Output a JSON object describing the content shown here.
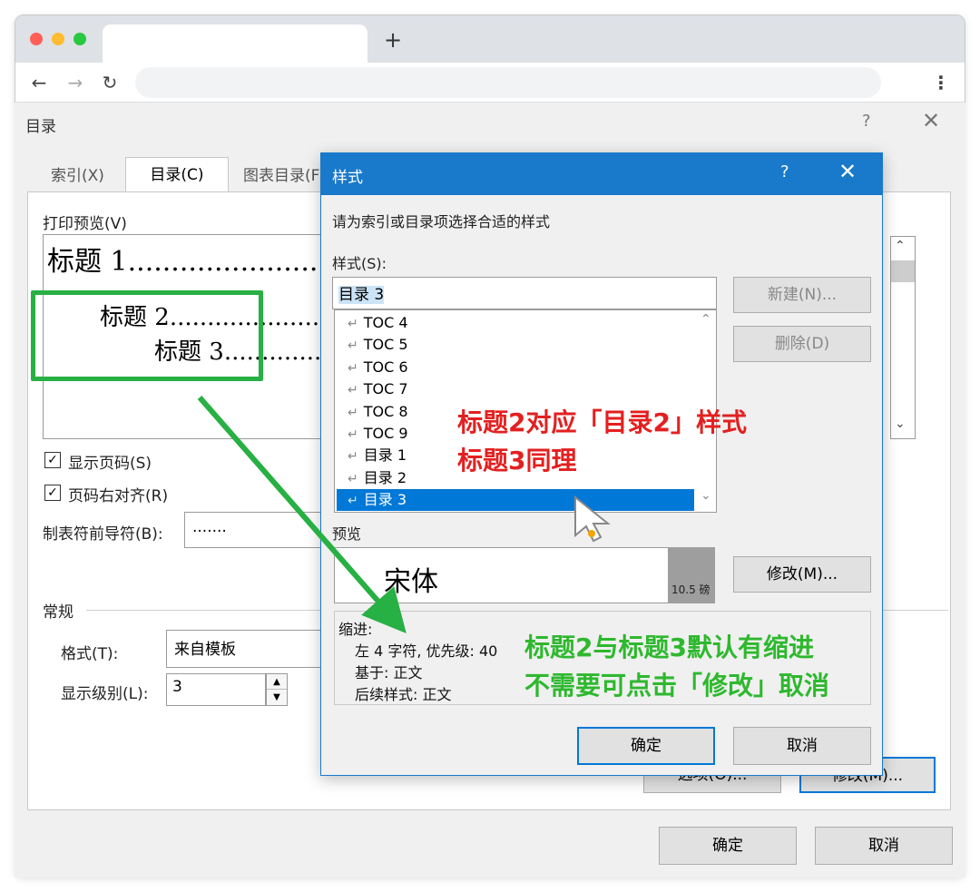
{
  "browser": {
    "new_tab_label": "+",
    "menu_dots": "⋮"
  },
  "toc_dialog": {
    "title": "目录",
    "help": "?",
    "close": "✕",
    "tabs": [
      {
        "label": "索引(X)"
      },
      {
        "label": "目录(C)"
      },
      {
        "label": "图表目录(F"
      }
    ],
    "print_preview_label": "打印预览(V)",
    "preview": {
      "h1": "标题  1",
      "h1_dots": ".........................",
      "h2": "标题  2",
      "h2_dots": ".........................",
      "h3": "标题  3",
      "h3_dots": "...................."
    },
    "show_page_numbers": "显示页码(S)",
    "right_align": "页码右对齐(R)",
    "tab_leader_label": "制表符前导符(B):",
    "tab_leader_value": ".......",
    "general_label": "常规",
    "format_label": "格式(T):",
    "format_value": "来自模板",
    "levels_label": "显示级别(L):",
    "levels_value": "3",
    "options_button": "选项(O)...",
    "modify_button": "修改(M)...",
    "ok": "确定",
    "cancel": "取消"
  },
  "style_dialog": {
    "title": "样式",
    "help": "?",
    "close": "✕",
    "instruction": "请为索引或目录项选择合适的样式",
    "styles_label": "样式(S):",
    "styles_value": "目录 3",
    "new_button": "新建(N)...",
    "delete_button": "删除(D)",
    "items": [
      {
        "label": "TOC 4"
      },
      {
        "label": "TOC 5"
      },
      {
        "label": "TOC 6"
      },
      {
        "label": "TOC 7"
      },
      {
        "label": "TOC 8"
      },
      {
        "label": "TOC 9"
      },
      {
        "label": "目录 1"
      },
      {
        "label": "目录 2"
      },
      {
        "label": "目录 3"
      }
    ],
    "selected_index": 8,
    "item_mark": "↵",
    "preview_label": "预览",
    "preview_font": "宋体",
    "preview_size": "10.5 磅",
    "modify_button": "修改(M)...",
    "desc": {
      "line1": "缩进:",
      "line2": "左  4 字符, 优先级: 40",
      "line3": "基于: 正文",
      "line4": "后续样式: 正文"
    },
    "ok": "确定",
    "cancel": "取消"
  },
  "annotations": {
    "red_line1": "标题2对应「目录2」样式",
    "red_line2": "标题3同理",
    "green_line1": "标题2与标题3默认有缩进",
    "green_line2": "不需要可点击「修改」取消"
  },
  "colors": {
    "title_bar": "#1979ca",
    "selection": "#0078d7",
    "annotation_red": "#e32020",
    "annotation_green": "#2eb82e"
  }
}
